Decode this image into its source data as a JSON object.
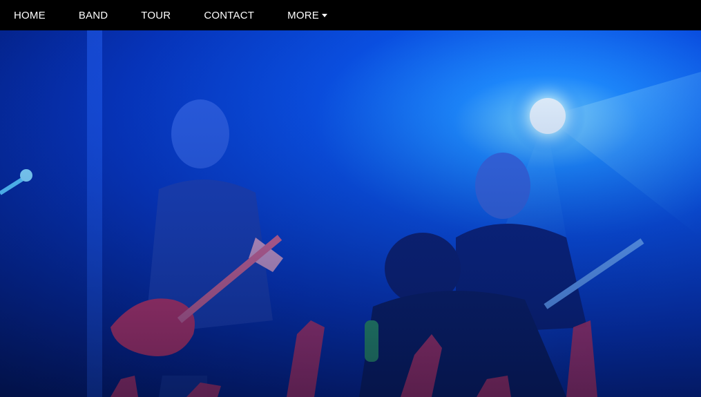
{
  "nav": {
    "items": [
      {
        "label": "HOME"
      },
      {
        "label": "BAND"
      },
      {
        "label": "TOUR"
      },
      {
        "label": "CONTACT"
      },
      {
        "label": "MORE",
        "icon": "caret-down-icon"
      }
    ]
  },
  "hero": {
    "image": "concert-photo",
    "colors": {
      "primary_light": "#1e8cff",
      "deep_blue": "#041f80",
      "spotlight": "#e8fbff",
      "hands_red": "#d8345a"
    }
  }
}
